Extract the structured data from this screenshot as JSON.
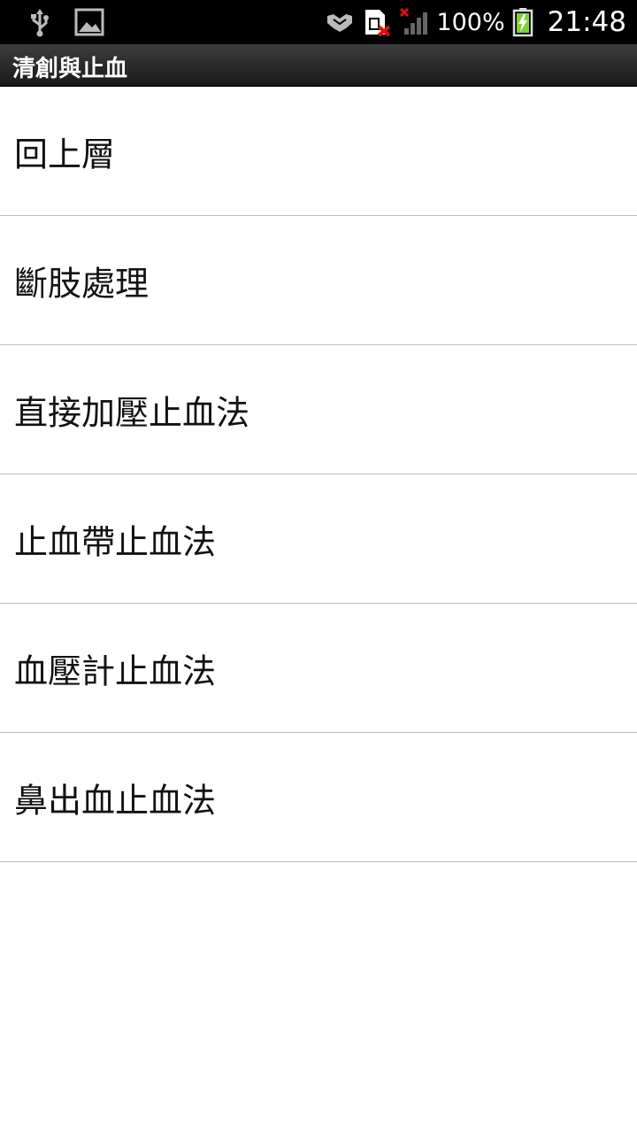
{
  "status_bar": {
    "battery_percent": "100%",
    "time": "21:48",
    "icons": [
      "usb-icon",
      "image-icon",
      "handshake-icon",
      "sim-missing-icon",
      "no-signal-icon",
      "battery-charging-icon"
    ]
  },
  "title_bar": {
    "title": "清創與止血"
  },
  "list": {
    "items": [
      {
        "label": "回上層"
      },
      {
        "label": "斷肢處理"
      },
      {
        "label": "直接加壓止血法"
      },
      {
        "label": "止血帶止血法"
      },
      {
        "label": "血壓計止血法"
      },
      {
        "label": "鼻出血止血法"
      }
    ]
  },
  "colors": {
    "status_bar_bg": "#000000",
    "title_bar_bg": "#2a2a2a",
    "list_bg": "#ffffff",
    "divider": "#bdbdbd",
    "sim_x": "#e01010",
    "battery_fill": "#7cd23a"
  }
}
